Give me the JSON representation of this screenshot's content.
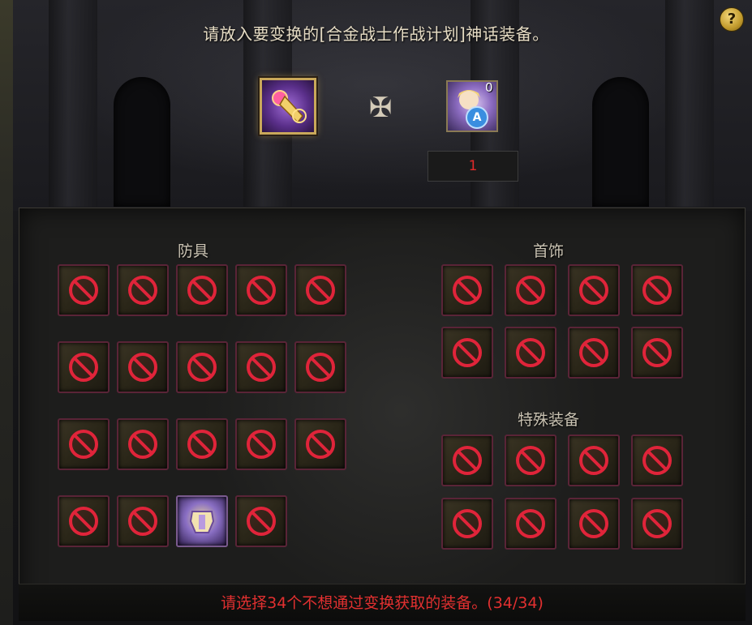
{
  "window": {
    "title": "请放入要变换的[合金战士作战计划]神话装备。",
    "help_label": "?"
  },
  "conversion": {
    "plus_symbol": "✠",
    "material_count": "0",
    "material_badge": "A",
    "quantity": "1"
  },
  "sections": {
    "armor": {
      "label": "防具",
      "slots": [
        "blocked",
        "blocked",
        "blocked",
        "blocked",
        "blocked",
        "blocked",
        "blocked",
        "blocked",
        "blocked",
        "blocked",
        "blocked",
        "blocked",
        "blocked",
        "blocked",
        "blocked",
        "blocked",
        "blocked",
        "equipment",
        "blocked"
      ]
    },
    "accessories": {
      "label": "首饰",
      "slots": [
        "blocked",
        "blocked",
        "blocked",
        "blocked",
        "blocked",
        "blocked",
        "blocked",
        "blocked"
      ]
    },
    "special": {
      "label": "特殊装备",
      "slots": [
        "blocked",
        "blocked",
        "blocked",
        "blocked",
        "blocked",
        "blocked",
        "blocked",
        "blocked"
      ]
    }
  },
  "footer": {
    "status": "请选择34个不想通过变换获取的装备。(34/34)"
  },
  "colors": {
    "status_red": "#e23030",
    "title_text": "#e6dcc4",
    "ban_red": "#e0243a"
  }
}
